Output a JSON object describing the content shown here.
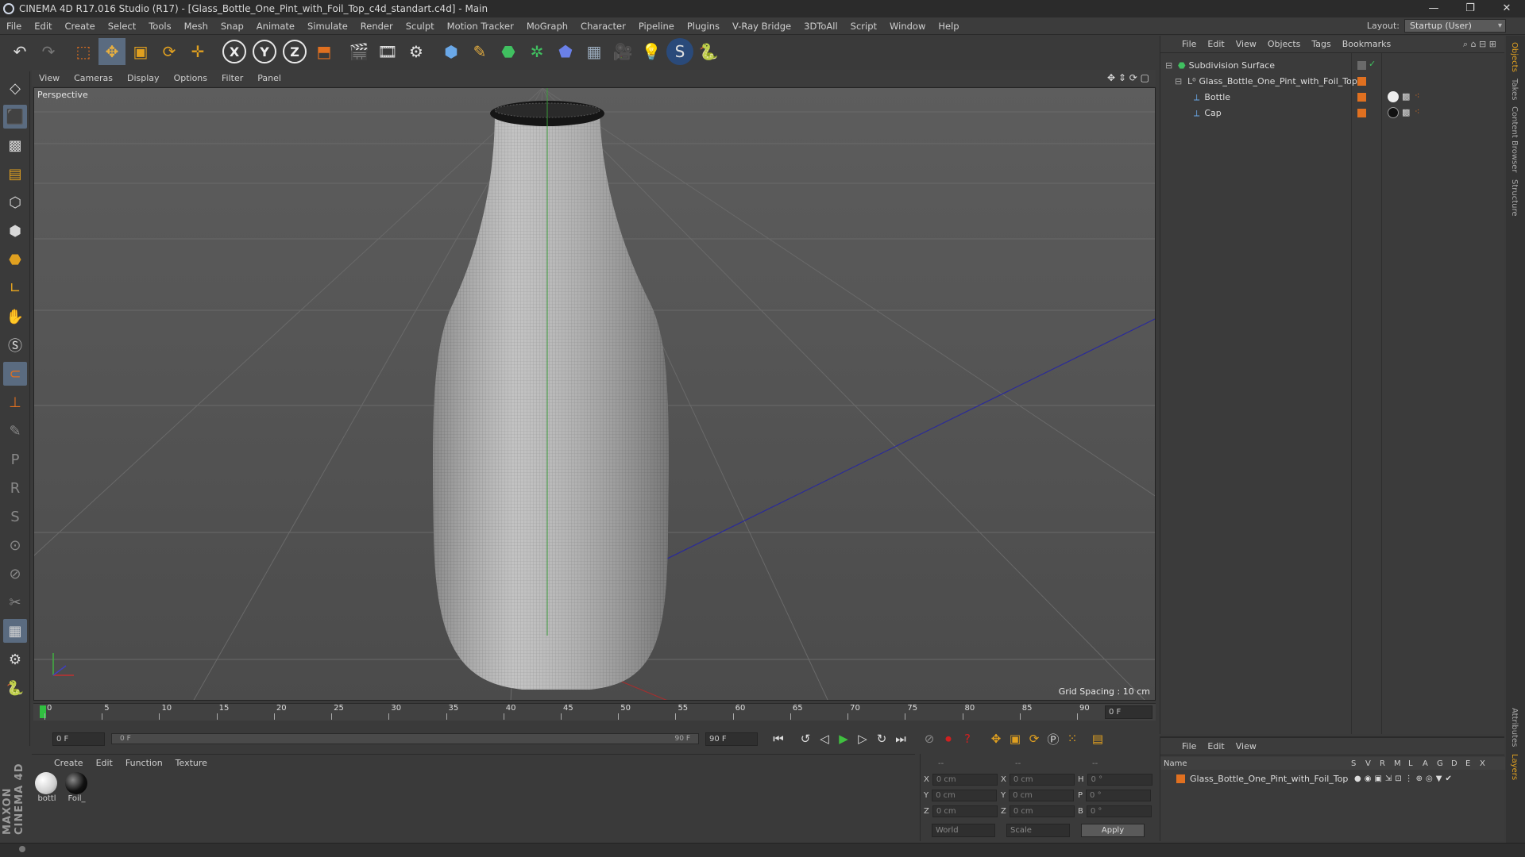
{
  "app": {
    "title": "CINEMA 4D R17.016 Studio (R17) - [Glass_Bottle_One_Pint_with_Foil_Top_c4d_standart.c4d] - Main",
    "window_controls": [
      "—",
      "❐",
      "✕"
    ]
  },
  "menubar": {
    "items": [
      "File",
      "Edit",
      "Create",
      "Select",
      "Tools",
      "Mesh",
      "Snap",
      "Animate",
      "Simulate",
      "Render",
      "Sculpt",
      "Motion Tracker",
      "MoGraph",
      "Character",
      "Pipeline",
      "Plugins",
      "V-Ray Bridge",
      "3DToAll",
      "Script",
      "Window",
      "Help"
    ],
    "layout_label": "Layout:",
    "layout_value": "Startup (User)"
  },
  "toolbar": {
    "axis_x": "X",
    "axis_y": "Y",
    "axis_z": "Z"
  },
  "viewport": {
    "menu": [
      "View",
      "Cameras",
      "Display",
      "Options",
      "Filter",
      "Panel"
    ],
    "camera_label": "Perspective",
    "grid_spacing": "Grid Spacing : 10 cm"
  },
  "timeline": {
    "ticks": [
      "0",
      "5",
      "10",
      "15",
      "20",
      "25",
      "30",
      "35",
      "40",
      "45",
      "50",
      "55",
      "60",
      "65",
      "70",
      "75",
      "80",
      "85",
      "90"
    ],
    "current_frame_right": "0 F"
  },
  "transport": {
    "start_field": "0 F",
    "range_start": "0 F",
    "range_end": "90 F",
    "end_field": "90 F"
  },
  "materials": {
    "menu": [
      "Create",
      "Edit",
      "Function",
      "Texture"
    ],
    "items": [
      {
        "label": "bottl",
        "color": "#e8e8e8"
      },
      {
        "label": "Foil_",
        "color": "#1a1a1a"
      }
    ]
  },
  "coordinates": {
    "header": [
      "--",
      "--",
      "--"
    ],
    "rows": [
      {
        "a": "X",
        "av": "0 cm",
        "b": "X",
        "bv": "0 cm",
        "c": "H",
        "cv": "0 °"
      },
      {
        "a": "Y",
        "av": "0 cm",
        "b": "Y",
        "bv": "0 cm",
        "c": "P",
        "cv": "0 °"
      },
      {
        "a": "Z",
        "av": "0 cm",
        "b": "Z",
        "bv": "0 cm",
        "c": "B",
        "cv": "0 °"
      }
    ],
    "mode": "World",
    "type": "Scale",
    "apply": "Apply"
  },
  "objects": {
    "menu": [
      "File",
      "Edit",
      "View",
      "Objects",
      "Tags",
      "Bookmarks"
    ],
    "tree": [
      {
        "name": "Subdivision Surface",
        "depth": 0
      },
      {
        "name": "Glass_Bottle_One_Pint_with_Foil_Top",
        "depth": 1
      },
      {
        "name": "Bottle",
        "depth": 2
      },
      {
        "name": "Cap",
        "depth": 2
      }
    ]
  },
  "layers": {
    "menu": [
      "File",
      "Edit",
      "View"
    ],
    "columns": [
      "Name",
      "S",
      "V",
      "R",
      "M",
      "L",
      "A",
      "G",
      "D",
      "E",
      "X"
    ],
    "rows": [
      {
        "name": "Glass_Bottle_One_Pint_with_Foil_Top"
      }
    ]
  },
  "right_tabs": [
    "Objects",
    "Takes",
    "Content Browser",
    "Structure",
    "Attributes",
    "Layers"
  ],
  "brand": "MAXON CINEMA 4D",
  "colors": {
    "accent_orange": "#e07020",
    "active_blue": "#5a6b80",
    "axis_x": "#c03030",
    "axis_y": "#30a030",
    "axis_z": "#3030c0"
  }
}
